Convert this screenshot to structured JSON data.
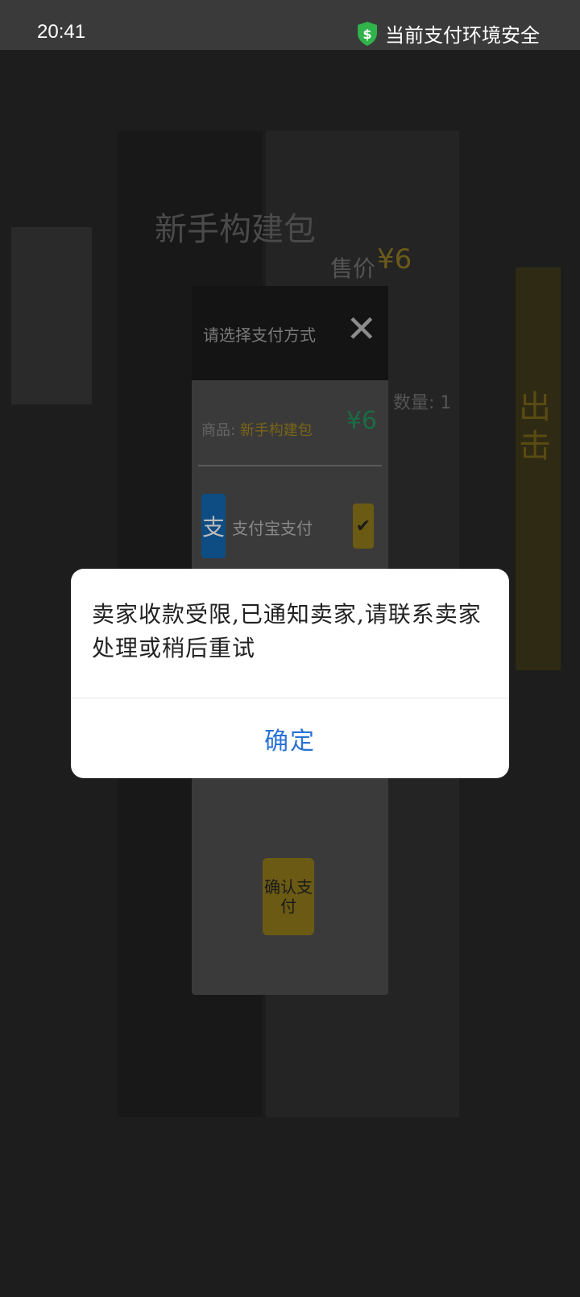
{
  "status_bar": {
    "time": "20:41",
    "secure_text": "当前支付环境安全",
    "shield_icon": "shield-dollar-icon",
    "shield_color": "#2fb34a"
  },
  "background": {
    "product_title": "新手构建包",
    "price_label": "售价",
    "price": "¥6",
    "quantity": "数量: 1",
    "side_promo": "出击",
    "pay_sheet": {
      "title": "请选择支付方式",
      "goods_label": "商品:",
      "goods_name": "新手构建包",
      "goods_price": "¥6",
      "alipay_icon_char": "支",
      "alipay_label": "支付宝支付",
      "confirm_label": "确认支付"
    }
  },
  "dialog": {
    "message": "卖家收款受限,已通知卖家,请联系卖家处理或稍后重试",
    "confirm_label": "确定",
    "accent_color": "#2a73d6"
  }
}
